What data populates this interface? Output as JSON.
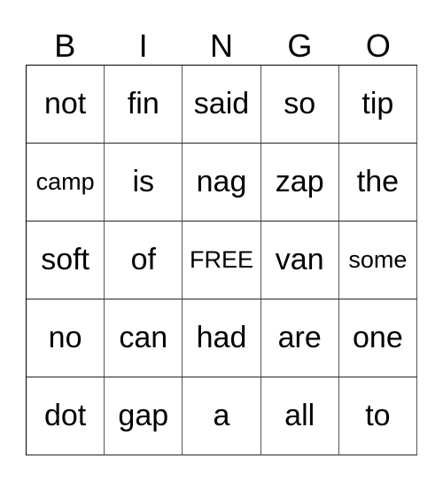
{
  "header": [
    "B",
    "I",
    "N",
    "G",
    "O"
  ],
  "cells": [
    [
      "not",
      "fin",
      "said",
      "so",
      "tip"
    ],
    [
      "camp",
      "is",
      "nag",
      "zap",
      "the"
    ],
    [
      "soft",
      "of",
      "FREE",
      "van",
      "some"
    ],
    [
      "no",
      "can",
      "had",
      "are",
      "one"
    ],
    [
      "dot",
      "gap",
      "a",
      "all",
      "to"
    ]
  ]
}
